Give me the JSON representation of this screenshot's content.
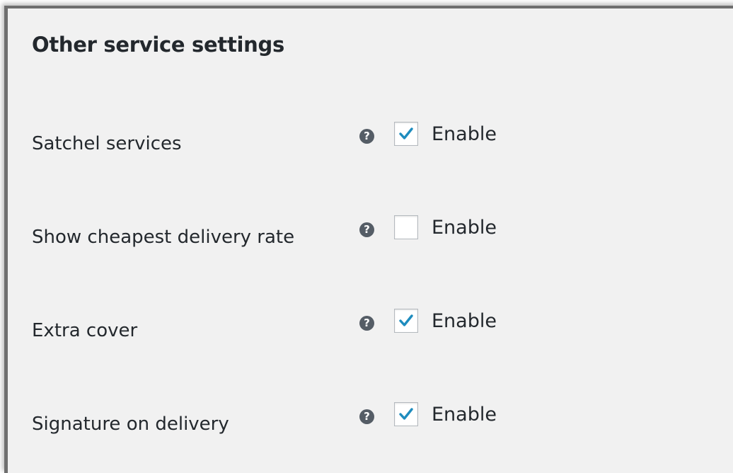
{
  "section": {
    "title": "Other service settings"
  },
  "colors": {
    "background": "#f1f1f1",
    "text": "#23282d",
    "checkmark": "#1e8cbe",
    "help_icon": "#555d66"
  },
  "settings": [
    {
      "label": "Satchel services",
      "help_icon": "question-circle-icon",
      "help_glyph": "?",
      "checkbox_label": "Enable",
      "checked": true
    },
    {
      "label": "Show cheapest delivery rate",
      "help_icon": "question-circle-icon",
      "help_glyph": "?",
      "checkbox_label": "Enable",
      "checked": false
    },
    {
      "label": "Extra cover",
      "help_icon": "question-circle-icon",
      "help_glyph": "?",
      "checkbox_label": "Enable",
      "checked": true
    },
    {
      "label": "Signature on delivery",
      "help_icon": "question-circle-icon",
      "help_glyph": "?",
      "checkbox_label": "Enable",
      "checked": true
    }
  ]
}
